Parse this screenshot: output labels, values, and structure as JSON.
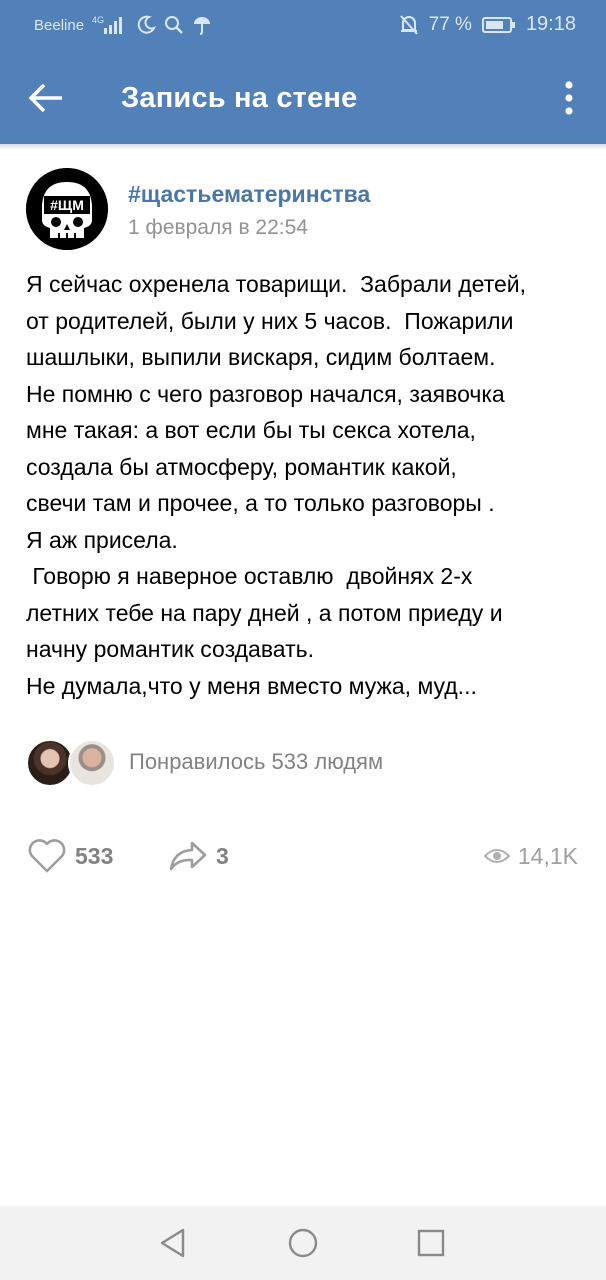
{
  "statusbar": {
    "carrier": "Beeline",
    "network": "4G",
    "battery": "77 %",
    "time": "19:18",
    "icons": [
      "signal-icon",
      "moon-icon",
      "search-icon",
      "umbrella-icon",
      "mute-bell-icon",
      "battery-icon"
    ]
  },
  "navbar": {
    "title": "Запись на стене",
    "back_icon": "arrow-left-icon",
    "more_icon": "more-vertical-icon"
  },
  "post": {
    "avatar_text": "#ЩМ",
    "group_name": "#щастьематеринства",
    "date": "1 февраля в 22:54",
    "lines": [
      "Я сейчас охренела товарищи.  Забрали детей,",
      "от родителей, были у них 5 часов.  Пожарили",
      "шашлыки, выпили вискаря, сидим болтаем.",
      "Не помню с чего разговор начался, заявочка",
      "мне такая: а вот если бы ты секса хотела,",
      "создала бы атмосферу, романтик какой,",
      "свечи там и прочее, а то только разговоры .",
      "Я аж присела.",
      " Говорю я наверное оставлю  двойнях 2-х",
      "летних тебе на пару дней , а потом приеду и",
      "начну романтик создавать.",
      "Не думала,что у меня вместо мужа, муд..."
    ],
    "likes_text": "Понравилось 533 людям"
  },
  "actions": {
    "likes": "533",
    "shares": "3",
    "views": "14,1K"
  },
  "colors": {
    "header": "#5181b8",
    "link": "#4a76a8",
    "muted": "#828282"
  }
}
